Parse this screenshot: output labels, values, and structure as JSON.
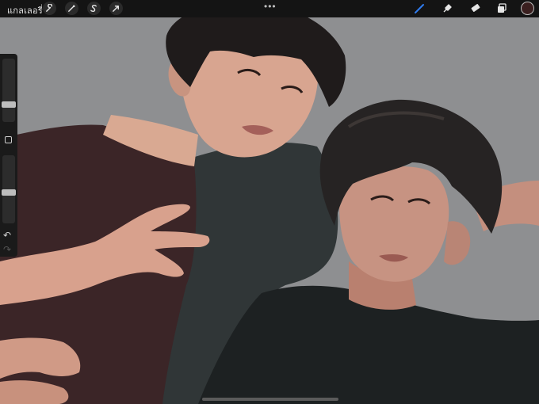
{
  "topbar": {
    "gallery_label": "แกลเลอรี่",
    "left_tools": [
      "wrench-icon",
      "adjustments-wand-icon",
      "selection-s-icon",
      "transform-arrow-icon"
    ],
    "more_label": "•••",
    "right_tools": [
      "brush-icon",
      "smudge-icon",
      "eraser-icon",
      "layers-icon"
    ],
    "active_color": "#3a1f1f",
    "active_tool_color": "#2f7cf0"
  },
  "sidebar": {
    "brush_size_fraction": 0.75,
    "opacity_fraction": 0.55
  },
  "canvas": {
    "background_color": "#8e8f91"
  }
}
